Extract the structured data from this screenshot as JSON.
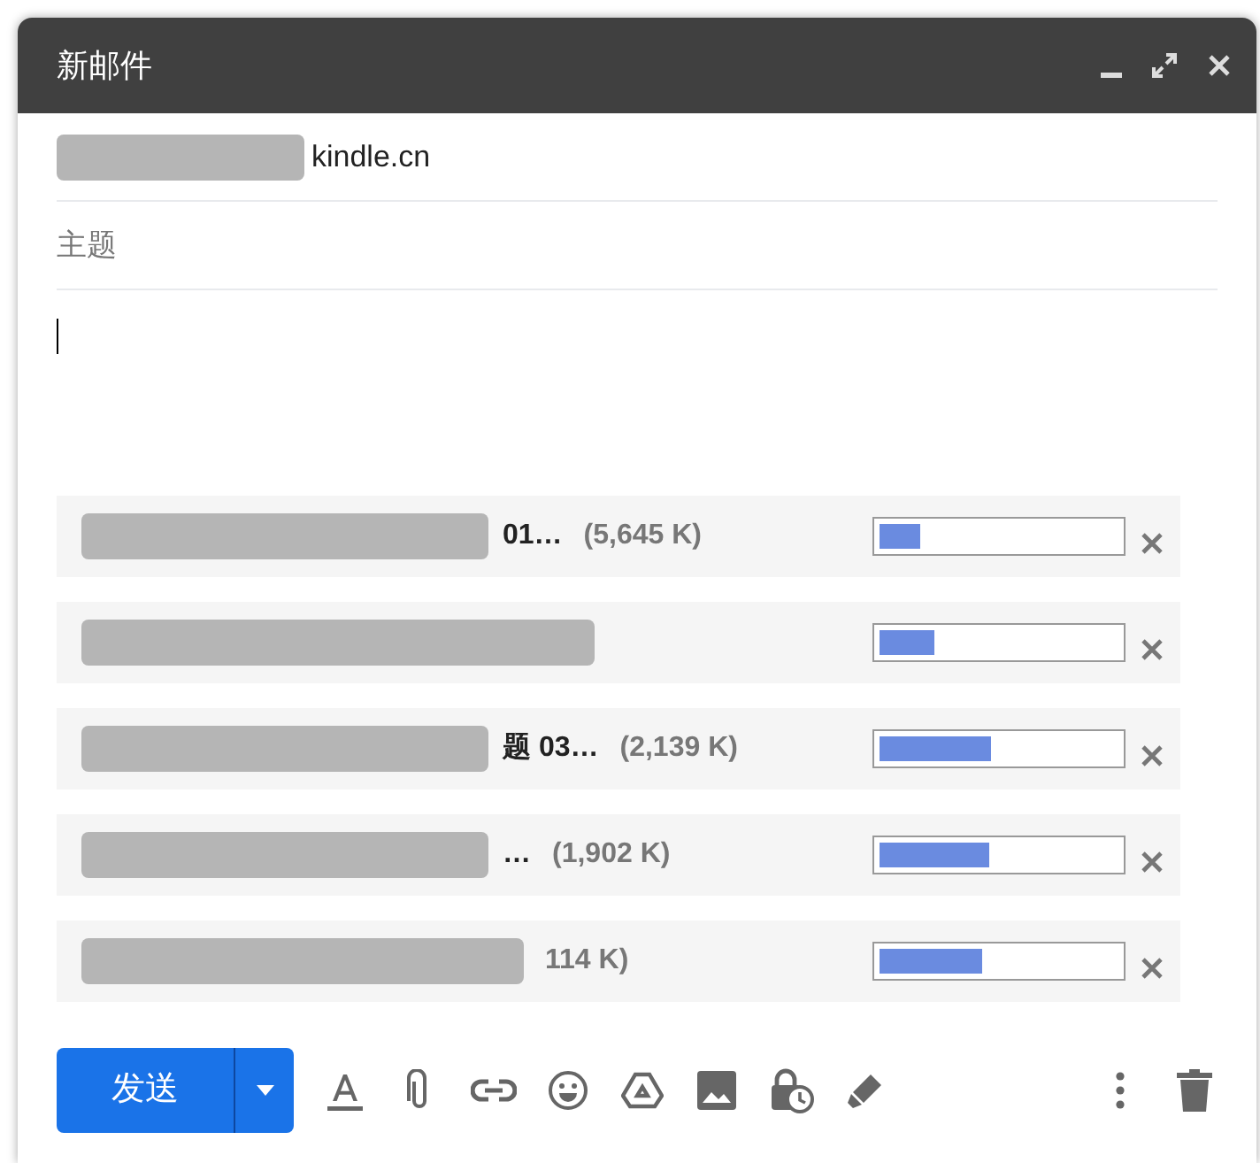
{
  "window": {
    "title": "新邮件"
  },
  "recipient": {
    "redacted": true,
    "value": "kindle.cn"
  },
  "subject": {
    "placeholder": "主题"
  },
  "attachments": [
    {
      "redacted": true,
      "name": "01…",
      "size": "(5,645 K)",
      "level": 0.17
    },
    {
      "redacted": true,
      "level": 0.23
    },
    {
      "redacted": true,
      "name": "题 03…",
      "size": "(2,139 K)",
      "level": 0.47
    },
    {
      "redacted": true,
      "name": "…",
      "size": "(1,902 K)",
      "level": 0.46
    },
    {
      "redacted": true,
      "size": "114 K)",
      "level": 0.43
    }
  ],
  "send_button": {
    "label": "发送"
  }
}
